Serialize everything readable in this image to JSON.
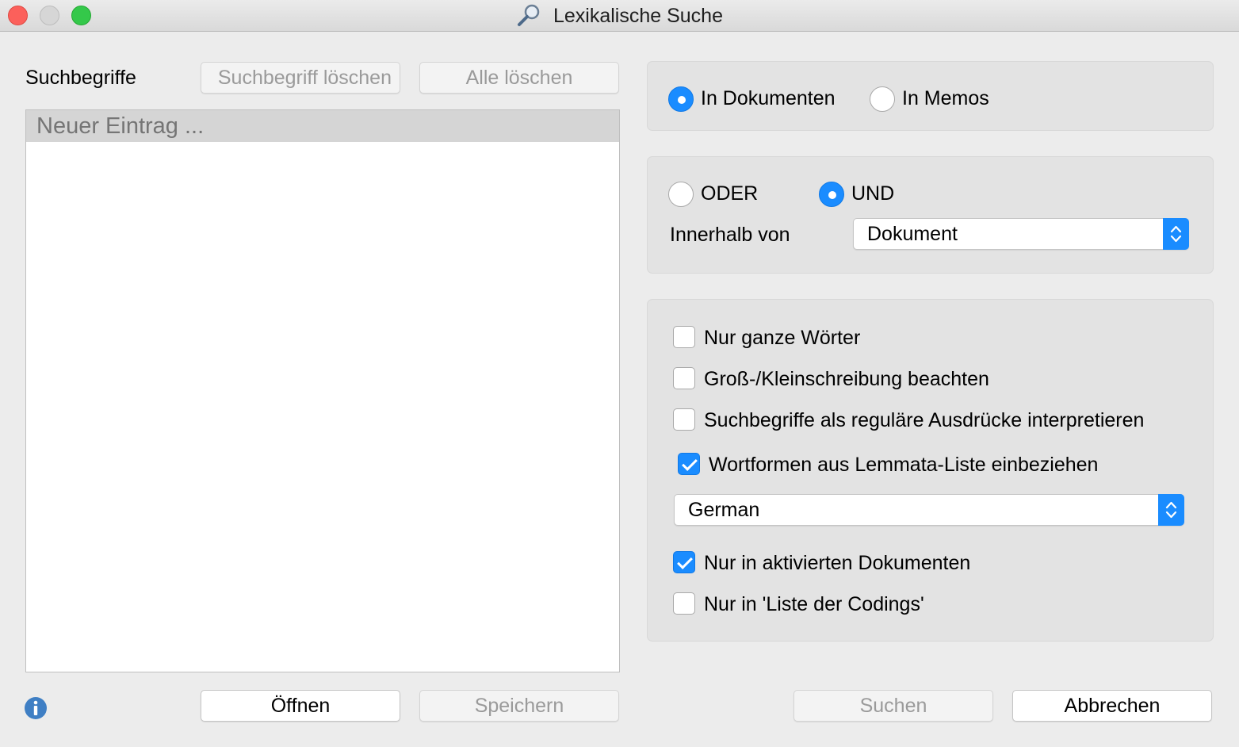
{
  "window": {
    "title": "Lexikalische Suche"
  },
  "left": {
    "search_terms_label": "Suchbegriffe",
    "delete_term_button": "Suchbegriff löschen",
    "delete_all_button": "Alle löschen",
    "list_new_entry": "Neuer Eintrag ...",
    "open_button": "Öffnen",
    "save_button": "Speichern"
  },
  "scope": {
    "in_documents": "In Dokumenten",
    "in_memos": "In Memos",
    "selected": "in_documents"
  },
  "logic": {
    "or_label": "ODER",
    "and_label": "UND",
    "selected": "and",
    "within_label": "Innerhalb von",
    "within_value": "Dokument"
  },
  "options": {
    "whole_words": {
      "label": "Nur ganze Wörter",
      "checked": false
    },
    "case_sensitive": {
      "label": "Groß-/Kleinschreibung beachten",
      "checked": false
    },
    "regex": {
      "label": "Suchbegriffe als reguläre Ausdrücke interpretieren",
      "checked": false
    },
    "lemmata": {
      "label": "Wortformen aus Lemmata-Liste einbeziehen",
      "checked": true
    },
    "language_value": "German",
    "activated_docs": {
      "label": "Nur in aktivierten Dokumenten",
      "checked": true
    },
    "codings_list": {
      "label": "Nur in 'Liste der Codings'",
      "checked": false
    }
  },
  "footer": {
    "search_button": "Suchen",
    "cancel_button": "Abbrechen"
  },
  "colors": {
    "accent": "#1a8cff",
    "info": "#3f7fc4"
  }
}
